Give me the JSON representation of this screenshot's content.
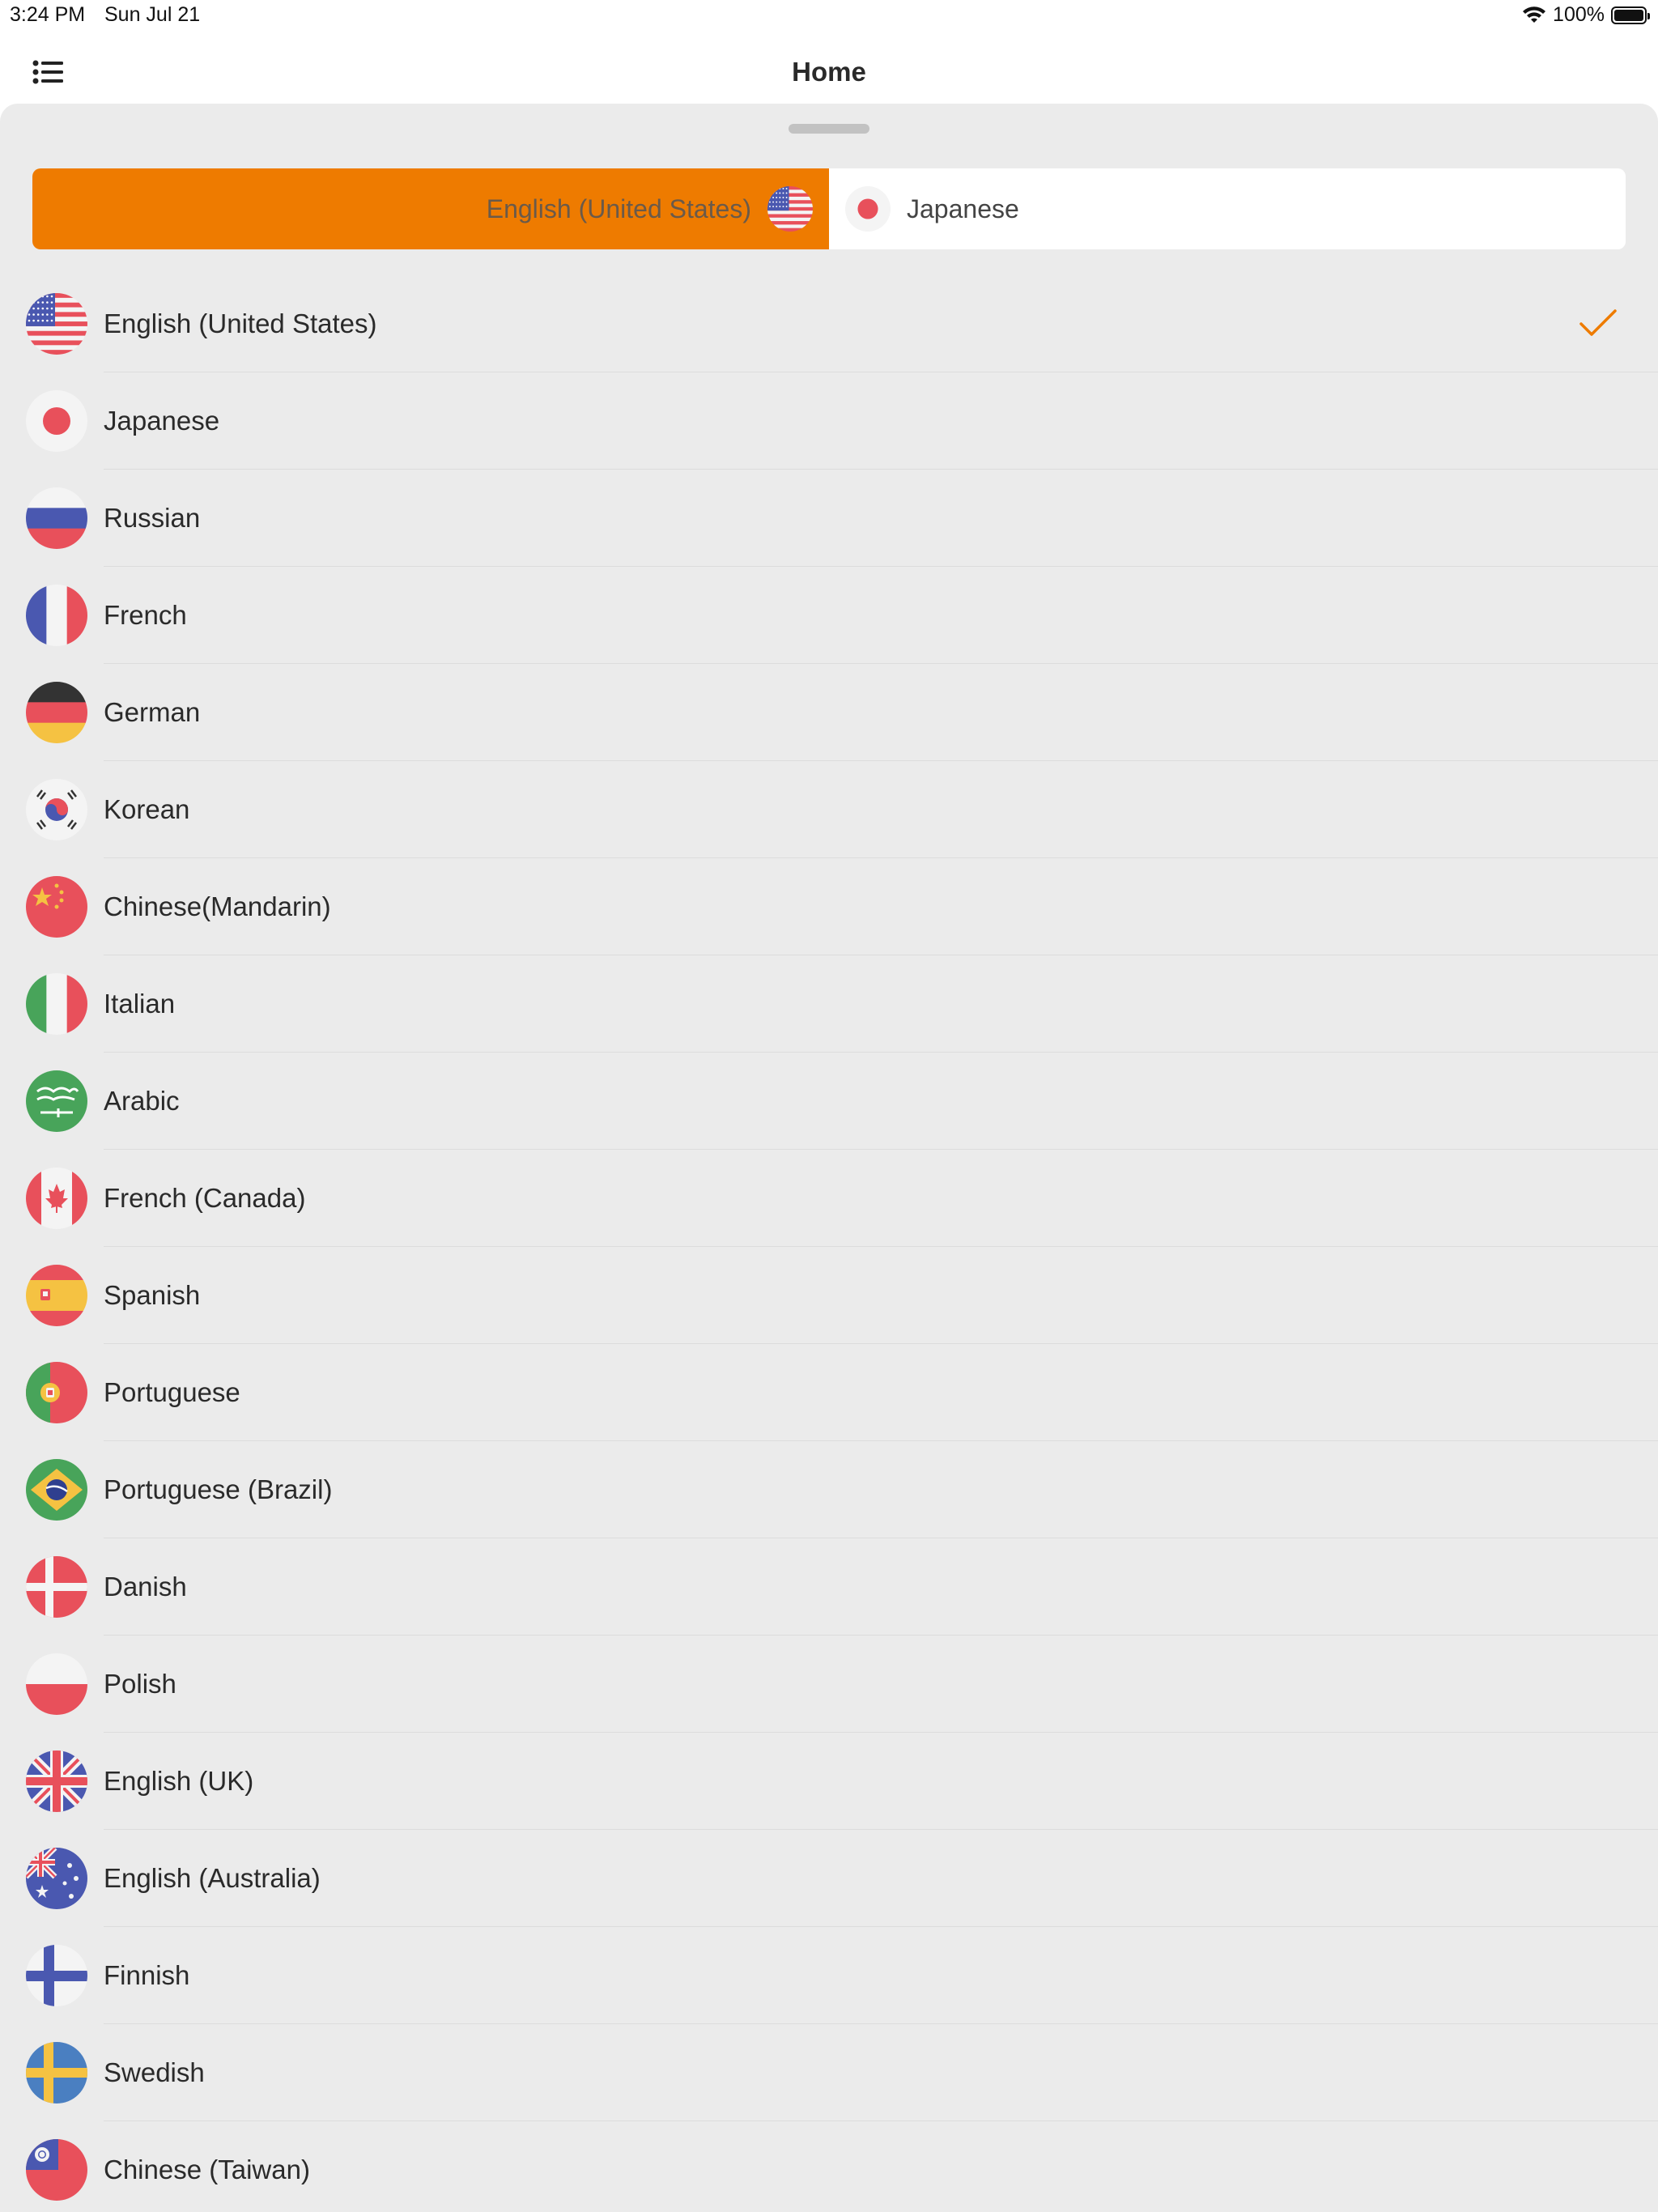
{
  "status_bar": {
    "time": "3:24 PM",
    "date": "Sun Jul 21",
    "battery": "100%"
  },
  "nav": {
    "title": "Home",
    "menu_icon": "list-icon"
  },
  "segment": {
    "source_label": "English (United States)",
    "source_flag": "us",
    "target_label": "Japanese",
    "target_flag": "jp",
    "accent": "#ee7b00"
  },
  "languages": [
    {
      "label": "English (United States)",
      "flag": "us",
      "selected": true
    },
    {
      "label": "Japanese",
      "flag": "jp"
    },
    {
      "label": "Russian",
      "flag": "ru"
    },
    {
      "label": "French",
      "flag": "fr"
    },
    {
      "label": "German",
      "flag": "de"
    },
    {
      "label": "Korean",
      "flag": "kr"
    },
    {
      "label": "Chinese(Mandarin)",
      "flag": "cn"
    },
    {
      "label": "Italian",
      "flag": "it"
    },
    {
      "label": "Arabic",
      "flag": "sa"
    },
    {
      "label": "French (Canada)",
      "flag": "ca"
    },
    {
      "label": "Spanish",
      "flag": "es"
    },
    {
      "label": "Portuguese",
      "flag": "pt"
    },
    {
      "label": "Portuguese (Brazil)",
      "flag": "br"
    },
    {
      "label": "Danish",
      "flag": "dk"
    },
    {
      "label": "Polish",
      "flag": "pl"
    },
    {
      "label": "English (UK)",
      "flag": "gb"
    },
    {
      "label": "English (Australia)",
      "flag": "au"
    },
    {
      "label": "Finnish",
      "flag": "fi"
    },
    {
      "label": "Swedish",
      "flag": "se"
    },
    {
      "label": "Chinese (Taiwan)",
      "flag": "tw"
    }
  ]
}
